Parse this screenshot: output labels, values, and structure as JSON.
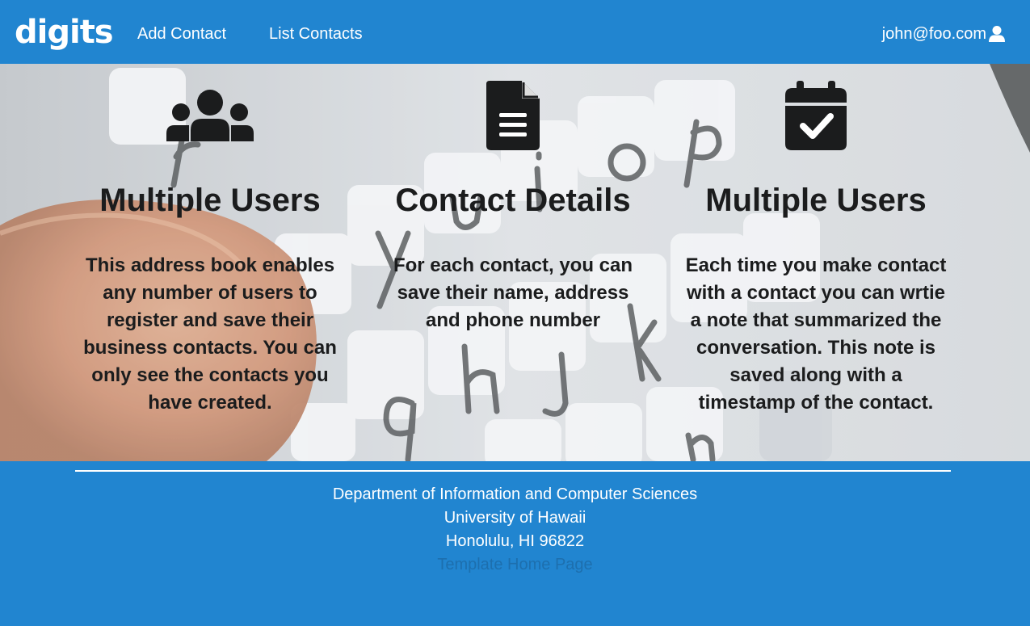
{
  "colors": {
    "brand_blue": "#2185d0",
    "text_dark": "#1b1c1d",
    "footer_link": "#1d6fae"
  },
  "navbar": {
    "brand": "digits",
    "links": [
      {
        "label": "Add Contact"
      },
      {
        "label": "List Contacts"
      }
    ],
    "user": {
      "email": "john@foo.com",
      "icon": "user-icon"
    }
  },
  "features": [
    {
      "icon": "users-icon",
      "title": "Multiple Users",
      "text": "This address book enables any number of users to register and save their business contacts. You can only see the contacts you have created."
    },
    {
      "icon": "file-text-icon",
      "title": "Contact Details",
      "text": "For each contact, you can save their name, address and phone number"
    },
    {
      "icon": "calendar-check-icon",
      "title": "Multiple Users",
      "text": "Each time you make contact with a contact you can wrtie a note that summarized the conversation. This note is saved along with a timestamp of the contact."
    }
  ],
  "footer": {
    "lines": [
      "Department of Information and Computer Sciences",
      "University of Hawaii",
      "Honolulu, HI 96822"
    ],
    "link": "Template Home Page"
  }
}
